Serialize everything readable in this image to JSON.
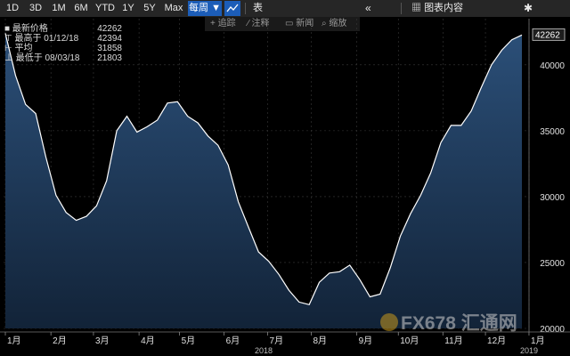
{
  "toolbar": {
    "ranges": [
      "1D",
      "3D",
      "1M",
      "6M",
      "YTD",
      "1Y",
      "5Y",
      "Max"
    ],
    "period_label": "每周 ▼",
    "table_label": "表",
    "collapse_label": "«",
    "content_label": "图表内容",
    "accent": "#1c5db8"
  },
  "subtoolbar": {
    "track": "追踪",
    "annotate": "注释",
    "news": "新闻",
    "zoom": "缩放"
  },
  "legend": {
    "rows": [
      {
        "label": "最新价格",
        "value": "42262"
      },
      {
        "label": "最高于 01/12/18",
        "value": "42394"
      },
      {
        "label": "平均",
        "value": "31858"
      },
      {
        "label": "最低于 08/03/18",
        "value": "21803"
      }
    ]
  },
  "last_value_tag": "42262",
  "watermark": "FX678 汇通网",
  "chart_data": {
    "type": "area",
    "x_unit": "week of 2018",
    "x": [
      0,
      1,
      2,
      3,
      4,
      5,
      6,
      7,
      8,
      9,
      10,
      11,
      12,
      13,
      14,
      15,
      16,
      17,
      18,
      19,
      20,
      21,
      22,
      23,
      24,
      25,
      26,
      27,
      28,
      29,
      30,
      31,
      32,
      33,
      34,
      35,
      36,
      37,
      38,
      39,
      40,
      41,
      42,
      43,
      44,
      45,
      46,
      47,
      48,
      49,
      50,
      51
    ],
    "y": [
      42394,
      39200,
      37000,
      36300,
      33000,
      30100,
      28800,
      28200,
      28500,
      29300,
      31200,
      35000,
      36100,
      34900,
      35300,
      35800,
      37100,
      37200,
      36100,
      35600,
      34600,
      33900,
      32400,
      29600,
      27700,
      25800,
      25100,
      24100,
      22900,
      22000,
      21803,
      23500,
      24200,
      24300,
      24800,
      23700,
      22400,
      22600,
      24600,
      27000,
      28700,
      30100,
      31800,
      34100,
      35400,
      35400,
      36500,
      38300,
      40000,
      41100,
      41900,
      42262
    ],
    "ylim": [
      20000,
      43500
    ],
    "yticks": [
      20000,
      25000,
      30000,
      35000,
      40000
    ],
    "xticks": [
      {
        "label": "1月",
        "x": 0
      },
      {
        "label": "2月",
        "x": 4.5
      },
      {
        "label": "3月",
        "x": 8.7
      },
      {
        "label": "4月",
        "x": 13.2
      },
      {
        "label": "5月",
        "x": 17.2
      },
      {
        "label": "6月",
        "x": 21.6
      },
      {
        "label": "7月",
        "x": 25.9
      },
      {
        "label": "8月",
        "x": 30.2
      },
      {
        "label": "9月",
        "x": 34.7
      },
      {
        "label": "10月",
        "x": 38.8
      },
      {
        "label": "11月",
        "x": 43.2
      },
      {
        "label": "12月",
        "x": 47.4
      },
      {
        "label": "1月",
        "x": 51.7
      }
    ],
    "year_labels": [
      {
        "label": "2018",
        "x": 25.5
      },
      {
        "label": "2019",
        "x": 51.7
      }
    ],
    "grid": true,
    "colors": {
      "line": "#ffffff",
      "fill_top": "#2b4f78",
      "fill_bottom": "#122338",
      "grid": "#3a3a3a"
    }
  }
}
